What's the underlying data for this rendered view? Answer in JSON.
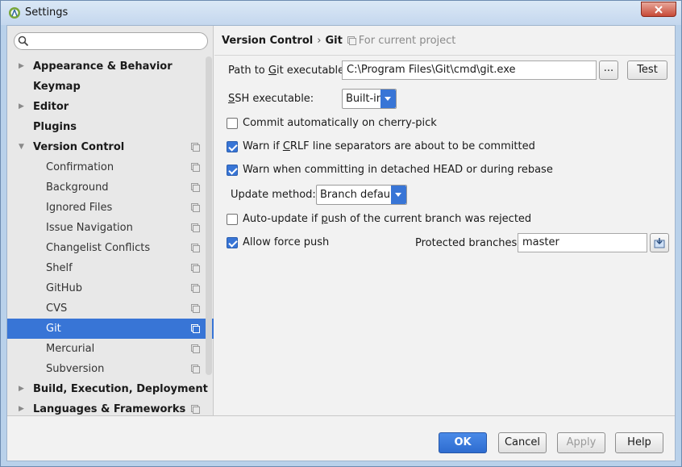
{
  "window": {
    "title": "Settings"
  },
  "search": {
    "placeholder": ""
  },
  "tree": [
    {
      "label": "Appearance & Behavior",
      "level": 0,
      "arrow": "right",
      "proj": false
    },
    {
      "label": "Keymap",
      "level": 0,
      "arrow": "",
      "proj": false
    },
    {
      "label": "Editor",
      "level": 0,
      "arrow": "right",
      "proj": false
    },
    {
      "label": "Plugins",
      "level": 0,
      "arrow": "",
      "proj": false
    },
    {
      "label": "Version Control",
      "level": 0,
      "arrow": "down",
      "proj": true
    },
    {
      "label": "Confirmation",
      "level": 1,
      "arrow": "",
      "proj": true
    },
    {
      "label": "Background",
      "level": 1,
      "arrow": "",
      "proj": true
    },
    {
      "label": "Ignored Files",
      "level": 1,
      "arrow": "",
      "proj": true
    },
    {
      "label": "Issue Navigation",
      "level": 1,
      "arrow": "",
      "proj": true
    },
    {
      "label": "Changelist Conflicts",
      "level": 1,
      "arrow": "",
      "proj": true
    },
    {
      "label": "Shelf",
      "level": 1,
      "arrow": "",
      "proj": true
    },
    {
      "label": "GitHub",
      "level": 1,
      "arrow": "",
      "proj": true
    },
    {
      "label": "CVS",
      "level": 1,
      "arrow": "",
      "proj": true
    },
    {
      "label": "Git",
      "level": 1,
      "arrow": "",
      "proj": true,
      "selected": true
    },
    {
      "label": "Mercurial",
      "level": 1,
      "arrow": "",
      "proj": true
    },
    {
      "label": "Subversion",
      "level": 1,
      "arrow": "",
      "proj": true
    },
    {
      "label": "Build, Execution, Deployment",
      "level": 0,
      "arrow": "right",
      "proj": false
    },
    {
      "label": "Languages & Frameworks",
      "level": 0,
      "arrow": "right",
      "proj": true
    }
  ],
  "breadcrumb": {
    "parent": "Version Control",
    "separator": "›",
    "current": "Git",
    "hint": "For current project"
  },
  "git": {
    "path_label_pre": "Path to ",
    "path_label_u": "G",
    "path_label_post": "it executable:",
    "path_value": "C:\\Program Files\\Git\\cmd\\git.exe",
    "browse_label": "...",
    "test_label": "Test",
    "ssh_label_u": "S",
    "ssh_label_post": "SH executable:",
    "ssh_value": "Built-in",
    "cherry_pick_label": "Commit automatically on cherry-pick",
    "cherry_pick_checked": false,
    "crlf_label_pre": "Warn if ",
    "crlf_label_u": "C",
    "crlf_label_post": "RLF line separators are about to be committed",
    "crlf_checked": true,
    "detached_label": "Warn when committing in detached HEAD or during rebase",
    "detached_checked": true,
    "update_method_label": "Update method:",
    "update_method_value": "Branch default",
    "auto_update_label_pre": "Auto-update if ",
    "auto_update_label_u": "p",
    "auto_update_label_post": "ush of the current branch was rejected",
    "auto_update_checked": false,
    "force_push_label": "Allow force push",
    "force_push_checked": true,
    "protected_label": "Protected branches:",
    "protected_value": "master"
  },
  "footer": {
    "ok": "OK",
    "cancel": "Cancel",
    "apply": "Apply",
    "help": "Help"
  },
  "colors": {
    "accent": "#3875d6",
    "selection": "#3875d6",
    "panel": "#f2f2f2",
    "sidebar": "#e8e8e8"
  }
}
